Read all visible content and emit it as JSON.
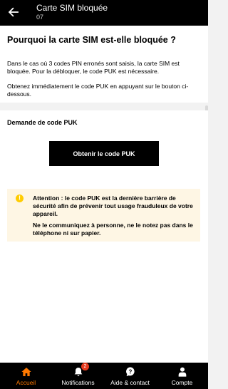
{
  "header": {
    "title": "Carte SIM bloquée",
    "subtitle": "07",
    "back_icon": "arrow-left-icon"
  },
  "intro": {
    "heading": "Pourquoi la carte SIM est-elle bloquée ?",
    "paragraph1": "Dans le cas où 3 codes PIN erronés sont saisis, la carte SIM est bloquée. Pour la débloquer, le code PUK est nécessaire.",
    "paragraph2": "Obtenez immédiatement le code PUK en appuyant sur le bouton ci-dessous."
  },
  "puk_section": {
    "label": "Demande de code PUK",
    "button_label": "Obtenir le code PUK"
  },
  "warning": {
    "icon": "exclamation-icon",
    "text1": "Attention : le code PUK est la dernière barrière de sécurité afin de prévenir tout usage frauduleux de votre appareil.",
    "text2": "Ne le communiquez à personne, ne le notez pas dans le téléphone ni sur papier."
  },
  "nav": {
    "items": [
      {
        "label": "Accueil",
        "icon": "home-icon",
        "active": true
      },
      {
        "label": "Notifications",
        "icon": "bell-icon",
        "badge": "2"
      },
      {
        "label": "Aide & contact",
        "icon": "help-bubble-icon"
      },
      {
        "label": "Compte",
        "icon": "user-icon"
      }
    ]
  },
  "colors": {
    "accent": "#ff7900",
    "badge": "#e63a1f",
    "warning_bg": "#fef6e4",
    "warning_icon": "#ffcc00"
  }
}
